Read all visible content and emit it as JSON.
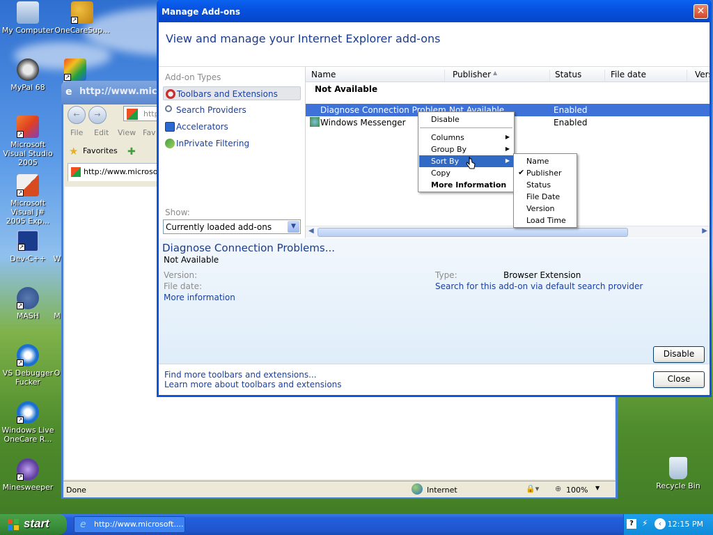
{
  "desktop": {
    "icons": [
      {
        "label": "My Computer",
        "icon": "computer-icon",
        "color": "#9fb8d8"
      },
      {
        "label": "OneCareSup...",
        "icon": "people-icon",
        "color": "#e0a020"
      },
      {
        "label": "MyPal 68",
        "icon": "raccoon-icon",
        "color": "#3a3a3a"
      },
      {
        "label": "Microsoft Visual Studio 2005",
        "icon": "visual-studio-icon",
        "color": "#d86a20"
      },
      {
        "label": "Microsoft Visual J# 2005 Exp...",
        "icon": "vjsharp-icon",
        "color": "#d84a20"
      },
      {
        "label": "Dev-C++",
        "icon": "devcpp-icon",
        "color": "#1a3c8c"
      },
      {
        "label": "MASH",
        "icon": "mash-icon",
        "color": "#2a4a8a"
      },
      {
        "label": "VS Debugger Fucker",
        "icon": "debugger-icon",
        "color": "#1a70d0"
      },
      {
        "label": "Windows Live OneCare R...",
        "icon": "onecare-icon",
        "color": "#1a70d0"
      },
      {
        "label": "Minesweeper",
        "icon": "mine-icon",
        "color": "#6040a0"
      }
    ],
    "recycle_bin": "Recycle Bin",
    "partial_labels": [
      "W",
      "M",
      "O"
    ]
  },
  "taskbar": {
    "start": "start",
    "task_label": "http://www.microsoft....",
    "clock": "12:15 PM"
  },
  "ie_window": {
    "title": "http://www.micros",
    "address_partial": "http:",
    "menu": [
      "File",
      "Edit",
      "View",
      "Fav"
    ],
    "favorites": "Favorites",
    "tab": "http://www.microsof",
    "status": "Done",
    "zone": "Internet",
    "zoom": "100%"
  },
  "dialog": {
    "title": "Manage Add-ons",
    "heading": "View and manage your Internet Explorer add-ons",
    "addon_types_label": "Add-on Types",
    "addon_types": [
      {
        "label": "Toolbars and Extensions",
        "icon": "toolbar-extension-icon"
      },
      {
        "label": "Search Providers",
        "icon": "search-icon"
      },
      {
        "label": "Accelerators",
        "icon": "accelerator-icon"
      },
      {
        "label": "InPrivate Filtering",
        "icon": "inprivate-icon"
      }
    ],
    "show_label": "Show:",
    "show_value": "Currently loaded add-ons",
    "columns": [
      "Name",
      "Publisher",
      "Status",
      "File date",
      "Vers"
    ],
    "group": "Not Available",
    "rows": [
      {
        "name": "Diagnose Connection Problem",
        "publisher": "Not Available",
        "status": "Enabled",
        "selected": true
      },
      {
        "name": "Windows Messenger",
        "publisher": "",
        "status": "Enabled",
        "selected": false
      }
    ],
    "details": {
      "title": "Diagnose Connection Problems...",
      "publisher": "Not Available",
      "version_label": "Version:",
      "file_date_label": "File date:",
      "more_info": "More information",
      "type_label": "Type:",
      "type_value": "Browser Extension",
      "search_link": "Search for this add-on via default search provider"
    },
    "footer_links": [
      "Find more toolbars and extensions...",
      "Learn more about toolbars and extensions"
    ],
    "disable_button": "Disable",
    "close_button": "Close"
  },
  "context_menu": {
    "items": [
      "Disable",
      "Columns",
      "Group By",
      "Sort By",
      "Copy",
      "More Information"
    ],
    "highlighted": "Sort By"
  },
  "sort_submenu": {
    "items": [
      "Name",
      "Publisher",
      "Status",
      "File Date",
      "Version",
      "Load Time"
    ],
    "checked": "Publisher"
  }
}
